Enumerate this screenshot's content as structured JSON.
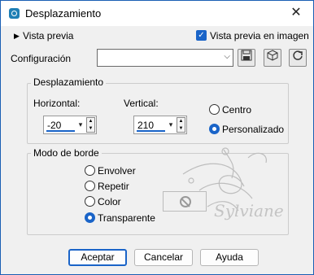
{
  "window": {
    "title": "Desplazamiento",
    "close": "✕"
  },
  "preview": {
    "label": "Vista previa",
    "image_preview_label": "Vista previa en imagen",
    "image_preview_checked": true
  },
  "config": {
    "label": "Configuración",
    "value": ""
  },
  "displacement": {
    "title": "Desplazamiento",
    "horizontal_label": "Horizontal:",
    "horizontal_value": "-20",
    "vertical_label": "Vertical:",
    "vertical_value": "210",
    "options": [
      {
        "label": "Centro",
        "selected": false
      },
      {
        "label": "Personalizado",
        "selected": true
      }
    ]
  },
  "border_mode": {
    "title": "Modo de borde",
    "options": [
      {
        "label": "Envolver",
        "selected": false
      },
      {
        "label": "Repetir",
        "selected": false
      },
      {
        "label": "Color",
        "selected": false
      },
      {
        "label": "Transparente",
        "selected": true
      }
    ]
  },
  "watermark": {
    "text": "Sylviane"
  },
  "buttons": {
    "accept": "Aceptar",
    "cancel": "Cancelar",
    "help": "Ayuda"
  },
  "colors": {
    "accent": "#1a64c8",
    "title_icon": "#1e7fb5"
  }
}
